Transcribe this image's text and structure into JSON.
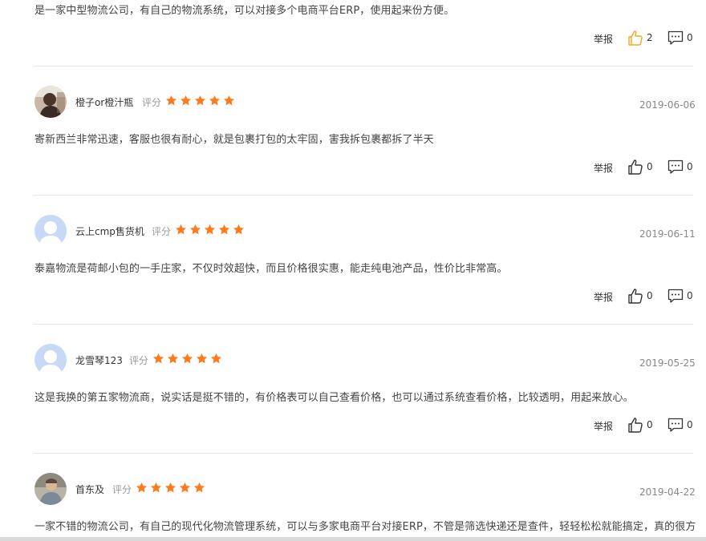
{
  "labels": {
    "report": "举报",
    "rating": "评分"
  },
  "colors": {
    "star": "#ff7a1a",
    "liked": "#f5a623"
  },
  "top_review": {
    "text": "是一家中型物流公司，有自己的物流系统，可以对接多个电商平台ERP，使用起来份方便。",
    "likes": "2",
    "comments": "0",
    "liked": true
  },
  "reviews": [
    {
      "username": "橙子or橙汁瓶",
      "avatar": "photo-avatar",
      "rating": 5,
      "date": "2019-06-06",
      "text": "寄新西兰非常迅速，客服也很有耐心，就是包裹打包的太牢固，害我拆包裹都拆了半天",
      "likes": "0",
      "comments": "0"
    },
    {
      "username": "云上cmp售货机",
      "avatar": "default-avatar",
      "rating": 5,
      "date": "2019-06-11",
      "text": "泰嘉物流是荷邮小包的一手庄家，不仅时效超快，而且价格很实惠，能走纯电池产品，性价比非常高。",
      "likes": "0",
      "comments": "0"
    },
    {
      "username": "龙雪琴123",
      "avatar": "default-avatar",
      "rating": 5,
      "date": "2019-05-25",
      "text": "这是我换的第五家物流商，说实话是挺不错的，有价格表可以自己查看价格，也可以通过系统查看价格，比较透明，用起来放心。",
      "likes": "0",
      "comments": "0"
    },
    {
      "username": "首东及",
      "avatar": "photo-avatar",
      "rating": 5,
      "date": "2019-04-22",
      "text": "一家不错的物流公司，有自己的现代化物流管理系统，可以与多家电商平台对接ERP，不管是筛选快递还是查件，轻轻松松就能搞定，真的很方"
    }
  ]
}
